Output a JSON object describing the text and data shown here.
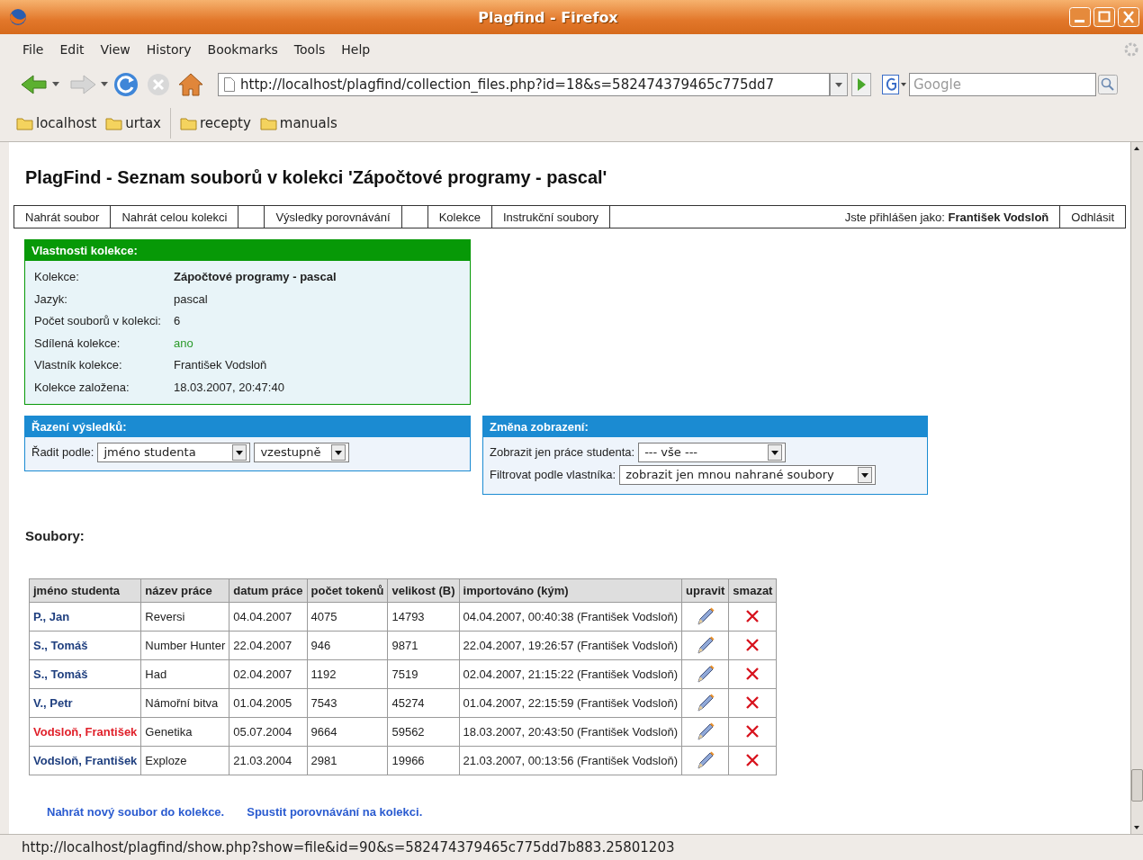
{
  "window": {
    "title": "Plagfind - Firefox"
  },
  "menu": [
    "File",
    "Edit",
    "View",
    "History",
    "Bookmarks",
    "Tools",
    "Help"
  ],
  "toolbar": {
    "url": "http://localhost/plagfind/collection_files.php?id=18&s=582474379465c775dd7",
    "search_placeholder": "Google"
  },
  "bookmarks": [
    {
      "label": "localhost",
      "kind": "folder"
    },
    {
      "label": "urtax",
      "kind": "folder"
    },
    {
      "kind": "separator"
    },
    {
      "label": "recepty",
      "kind": "folder"
    },
    {
      "label": "manuals",
      "kind": "folder"
    }
  ],
  "page": {
    "heading": "PlagFind - Seznam souborů v kolekci 'Zápočtové programy - pascal'",
    "nav": [
      {
        "kind": "link",
        "label": "Nahrát soubor"
      },
      {
        "kind": "link",
        "label": "Nahrát celou kolekci"
      },
      {
        "kind": "blank"
      },
      {
        "kind": "link",
        "label": "Výsledky porovnávání"
      },
      {
        "kind": "blank"
      },
      {
        "kind": "link",
        "label": "Kolekce"
      },
      {
        "kind": "link",
        "label": "Instrukční soubory"
      },
      {
        "kind": "user",
        "label": "Jste přihlášen jako: **František Vodsloň**"
      },
      {
        "kind": "link",
        "label": "Odhlásit"
      }
    ],
    "properties": {
      "title": "Vlastnosti kolekce:",
      "rows": [
        {
          "label": "Kolekce:",
          "value": "Zápočtové programy - pascal",
          "kind": "bold"
        },
        {
          "label": "Jazyk:",
          "value": "pascal",
          "kind": "plain"
        },
        {
          "label": "Počet souborů v kolekci:",
          "value": "6",
          "kind": "plain"
        },
        {
          "label": "Sdílená kolekce:",
          "value": "ano",
          "kind": "yes"
        },
        {
          "label": "Vlastník kolekce:",
          "value": "František Vodsloň",
          "kind": "plain"
        },
        {
          "label": "Kolekce založena:",
          "value": "18.03.2007, 20:47:40",
          "kind": "plain"
        }
      ]
    },
    "sorting": {
      "title": "Řazení výsledků:",
      "label": "Řadit podle:",
      "selects": [
        "jméno studenta",
        "vzestupně"
      ]
    },
    "display": {
      "title": "Změna zobrazení:",
      "rows": [
        {
          "label": "Zobrazit jen práce studenta:",
          "value": "--- vše ---"
        },
        {
          "label": "Filtrovat podle vlastníka:",
          "value": "zobrazit jen mnou nahrané soubory"
        }
      ]
    },
    "files": {
      "title": "Soubory:",
      "columns": [
        "jméno studenta",
        "název práce",
        "datum práce",
        "počet tokenů",
        "velikost (B)",
        "importováno (kým)",
        "upravit",
        "smazat"
      ],
      "rows": [
        {
          "student": "P., Jan",
          "color": "#1f3f7f",
          "work": "Reversi",
          "date": "04.04.2007",
          "tokens": "4075",
          "size": "14793",
          "imported": "04.04.2007, 00:40:38 (František Vodsloň)"
        },
        {
          "student": "S., Tomáš",
          "color": "#1f3f7f",
          "work": "Number Hunter",
          "date": "22.04.2007",
          "tokens": "946",
          "size": "9871",
          "imported": "22.04.2007, 19:26:57 (František Vodsloň)"
        },
        {
          "student": "S., Tomáš",
          "color": "#1f3f7f",
          "work": "Had",
          "date": "02.04.2007",
          "tokens": "1192",
          "size": "7519",
          "imported": "02.04.2007, 21:15:22 (František Vodsloň)"
        },
        {
          "student": "V., Petr",
          "color": "#1f3f7f",
          "work": "Námořní bitva",
          "date": "01.04.2005",
          "tokens": "7543",
          "size": "45274",
          "imported": "01.04.2007, 22:15:59 (František Vodsloň)"
        },
        {
          "student": "Vodsloň, František",
          "color": "#e0202a",
          "work": "Genetika",
          "date": "05.07.2004",
          "tokens": "9664",
          "size": "59562",
          "imported": "18.03.2007, 20:43:50 (František Vodsloň)"
        },
        {
          "student": "Vodsloň, František",
          "color": "#1f3f7f",
          "work": "Exploze",
          "date": "21.03.2004",
          "tokens": "2981",
          "size": "19966",
          "imported": "21.03.2007, 00:13:56 (František Vodsloň)"
        }
      ]
    },
    "links": [
      "Nahrát nový soubor do kolekce.",
      "Spustit porovnávání na kolekci."
    ]
  },
  "status_bar": "http://localhost/plagfind/show.php?show=file&id=90&s=582474379465c775dd7b883.25801203"
}
